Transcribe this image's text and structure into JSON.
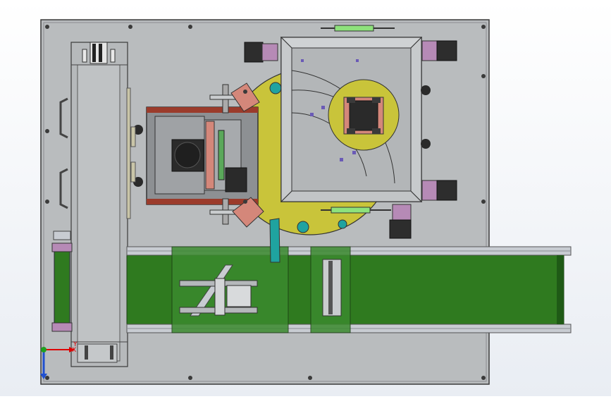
{
  "view": {
    "triad": {
      "x_label": "X",
      "y_label": "Y"
    }
  },
  "colors": {
    "plate": "#b9bcbe",
    "plate_edge": "#4a4a4a",
    "conveyor_belt": "#2f7a1f",
    "rail": "#c8ccd2",
    "turntable": "#c9c43a",
    "cyan_part": "#1fa3a0",
    "pink_part": "#d4877a",
    "violet_part": "#b68ab6",
    "green_cylinder": "#8ee27c",
    "block_dark": "#2d2d2d",
    "steel": "#7e8286"
  },
  "components": [
    "base-plate",
    "left-slide-module",
    "flip-station",
    "rotary-turntable",
    "square-fixture-box",
    "round-chuck",
    "belt-conveyor",
    "pusher-cylinder",
    "coordinate-triad"
  ]
}
